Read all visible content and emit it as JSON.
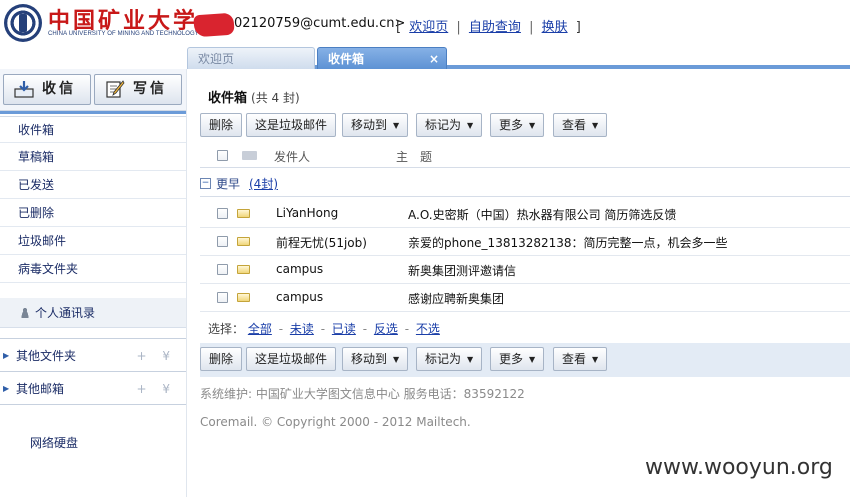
{
  "header": {
    "logo_cn": "中国矿业大学",
    "logo_en": "CHINA UNIVERSITY OF MINING AND TECHNOLOGY",
    "user_address": "02120759@cumt.edu.cn>",
    "links": {
      "open_bracket": "[",
      "welcome": "欢迎页",
      "separator": "|",
      "self_query": "自助查询",
      "skin": "换肤",
      "close_bracket": "]"
    }
  },
  "tabs": [
    {
      "label": "欢迎页",
      "active": false
    },
    {
      "label": "收件箱",
      "active": true,
      "close": "×"
    }
  ],
  "sidebar": {
    "receive_label": "收信",
    "write_label": "写信",
    "folders": [
      "收件箱",
      "草稿箱",
      "已发送",
      "已删除",
      "垃圾邮件",
      "病毒文件夹"
    ],
    "contacts_label": "个人通讯录",
    "other_folders_label": "其他文件夹",
    "other_mailboxes_label": "其他邮箱",
    "folder_actions": "+ ¥",
    "netdisk_label": "网络硬盘"
  },
  "main": {
    "title": "收件箱",
    "count_text": "(共 4 封)",
    "toolbar": {
      "delete": "删除",
      "spam": "这是垃圾邮件",
      "move_to": "移动到",
      "mark_as": "标记为",
      "more": "更多",
      "view": "查看",
      "dropdown_glyph": "▼"
    },
    "columns": {
      "sender": "发件人",
      "subject": "主　题"
    },
    "group": {
      "toggle": "−",
      "label": "更早",
      "count": "(4封)"
    },
    "messages": [
      {
        "sender": "LiYanHong",
        "subject": "A.O.史密斯（中国）热水器有限公司 简历筛选反馈"
      },
      {
        "sender": "前程无忧(51job)",
        "subject": "亲爱的phone_13813282138：简历完整一点，机会多一些"
      },
      {
        "sender": "campus",
        "subject": "新奥集团测评邀请信"
      },
      {
        "sender": "campus",
        "subject": "感谢应聘新奥集团"
      }
    ],
    "select": {
      "label": "选择：",
      "all": "全部",
      "unread": "未读",
      "read": "已读",
      "invert": "反选",
      "none": "不选",
      "separator": "-"
    },
    "footer_info": "系统维护: 中国矿业大学图文信息中心 服务电话：83592122",
    "footer_copy": "Coremail. © Copyright 2000 - 2012 Mailtech."
  },
  "watermark": "www.wooyun.org",
  "colors": {
    "accent_blue": "#6b9bd8",
    "tab_active": "#5d92d4",
    "logo_red": "#c81818",
    "link": "#1a3ea8"
  }
}
